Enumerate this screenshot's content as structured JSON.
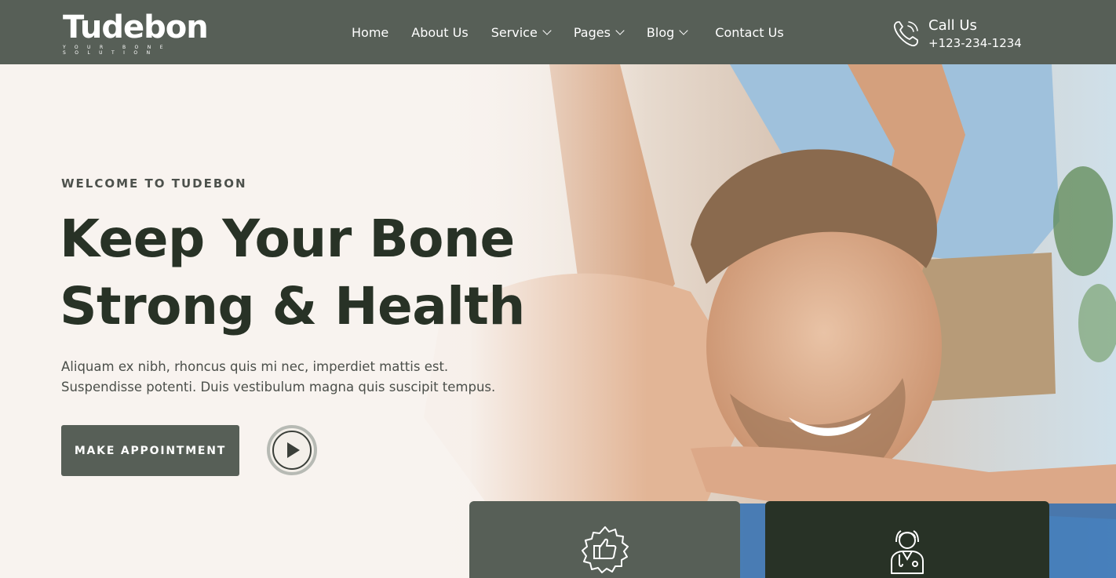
{
  "brand": {
    "name": "Tudebon",
    "tagline": "YOUR BONE SOLUTION"
  },
  "nav": {
    "items": [
      {
        "label": "Home",
        "has_dropdown": false
      },
      {
        "label": "About Us",
        "has_dropdown": false
      },
      {
        "label": "Service",
        "has_dropdown": true
      },
      {
        "label": "Pages",
        "has_dropdown": true
      },
      {
        "label": "Blog",
        "has_dropdown": true
      },
      {
        "label": "Contact Us",
        "has_dropdown": false
      }
    ]
  },
  "call": {
    "icon": "phone-icon",
    "title": "Call Us",
    "phone": "+123-234-1234"
  },
  "hero": {
    "eyebrow": "WELCOME TO TUDEBON",
    "headline_line1": "Keep Your Bone",
    "headline_line2": "Strong & Health",
    "lead": "Aliquam ex nibh, rhoncus quis mi nec, imperdiet mattis est. Suspendisse potenti. Duis vestibulum magna quis suscipit tempus.",
    "cta_label": "MAKE APPOINTMENT",
    "play_icon": "play-icon"
  },
  "feature_cards": [
    {
      "icon": "award-thumbs-up-icon"
    },
    {
      "icon": "doctor-icon"
    }
  ],
  "colors": {
    "header_bg": "#575f57",
    "heading": "#283226",
    "button_bg": "#575f57",
    "card_dark": "#283226",
    "text_muted": "#4b4f4a"
  }
}
